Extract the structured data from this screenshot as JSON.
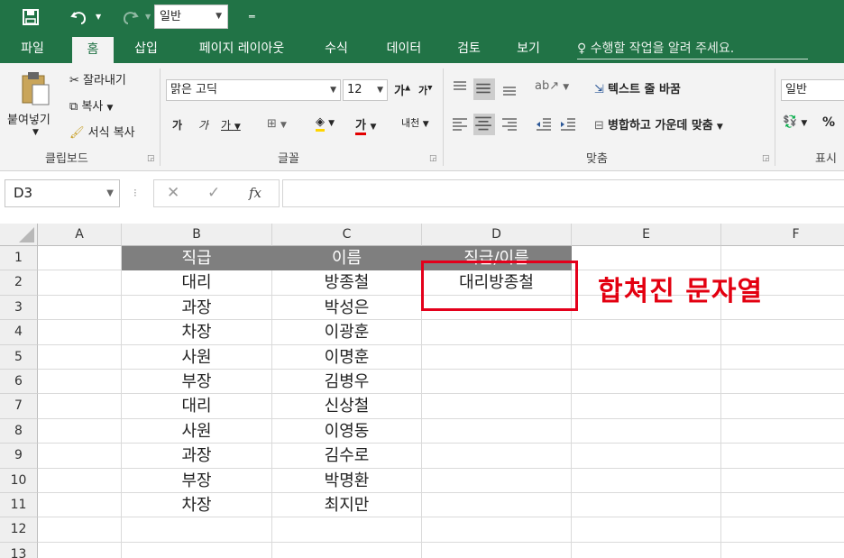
{
  "qat": {
    "save_icon": "save-icon",
    "undo_icon": "undo-icon",
    "redo_icon": "redo-icon",
    "number_format": "일반",
    "customize": "▼"
  },
  "tabs": [
    "파일",
    "홈",
    "삽입",
    "페이지 레이아웃",
    "수식",
    "데이터",
    "검토",
    "보기"
  ],
  "active_tab": "홈",
  "tell_me": "수행할 작업을 알려 주세요.",
  "clipboard": {
    "paste": "붙여넣기",
    "cut": "잘라내기",
    "copy": "복사",
    "format_painter": "서식 복사",
    "label": "클립보드"
  },
  "font": {
    "name": "맑은 고딕",
    "size": "12",
    "grow": "가",
    "shrink": "가",
    "bold": "가",
    "italic": "가",
    "underline": "가",
    "font_color": "가",
    "phonetic": "내천",
    "label": "글꼴"
  },
  "alignment": {
    "wrap_text": "텍스트 줄 바꿈",
    "merge_center": "병합하고 가운데 맞춤",
    "label": "맞춤"
  },
  "number": {
    "format": "일반",
    "percent": "%",
    "label": "표시"
  },
  "formula_bar": {
    "name_box": "D3",
    "cancel": "✕",
    "enter": "✓",
    "fx": "fx",
    "content": ""
  },
  "columns": [
    "A",
    "B",
    "C",
    "D",
    "E",
    "F"
  ],
  "rows": [
    "1",
    "2",
    "3",
    "4",
    "5",
    "6",
    "7",
    "8",
    "9",
    "10",
    "11",
    "12",
    "13"
  ],
  "sheet": {
    "header": [
      "직급",
      "이름",
      "직급/이름"
    ],
    "data": [
      [
        "대리",
        "방종철",
        "대리방종철"
      ],
      [
        "과장",
        "박성은",
        ""
      ],
      [
        "차장",
        "이광훈",
        ""
      ],
      [
        "사원",
        "이명훈",
        ""
      ],
      [
        "부장",
        "김병우",
        ""
      ],
      [
        "대리",
        "신상철",
        ""
      ],
      [
        "사원",
        "이영동",
        ""
      ],
      [
        "과장",
        "김수로",
        ""
      ],
      [
        "부장",
        "박명환",
        ""
      ],
      [
        "차장",
        "최지만",
        ""
      ]
    ]
  },
  "annotation": "합쳐진 문자열",
  "colors": {
    "excel_green": "#217346",
    "header_fill": "#7f7f7f",
    "annotation_red": "#e30010"
  }
}
